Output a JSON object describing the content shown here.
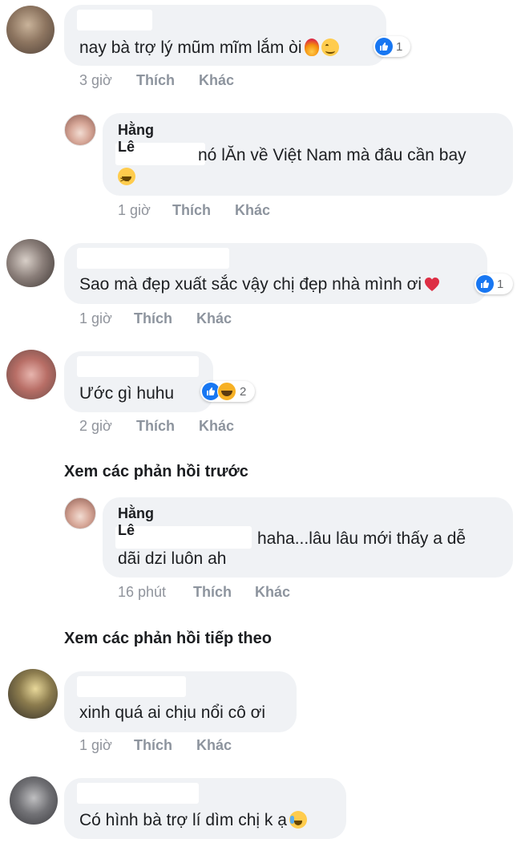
{
  "comments": [
    {
      "text": "nay bà trợ lý mũm mĩm lắm òi",
      "emoji": [
        "fire",
        "smile"
      ],
      "reaction_count": "1",
      "time": "3 giờ",
      "like_label": "Thích",
      "more_label": "Khác"
    },
    {
      "name": "Hằng Lê",
      "text_line1": "nó lĂn về Việt Nam mà đâu cần bay",
      "emoji": [
        "laugh"
      ],
      "time": "1 giờ",
      "like_label": "Thích",
      "more_label": "Khác"
    },
    {
      "text": "Sao mà đẹp xuất sắc vậy chị đẹp nhà mình ơi",
      "emoji": [
        "heart"
      ],
      "reaction_count": "1",
      "time": "1 giờ",
      "like_label": "Thích",
      "more_label": "Khác"
    },
    {
      "text": "Ước gì huhu",
      "reaction_count": "2",
      "time": "2 giờ",
      "like_label": "Thích",
      "more_label": "Khác"
    },
    {
      "name": "Hằng Lê",
      "text_line1": "haha...lâu lâu mới thấy a dễ",
      "text_line2": "dãi dzi luôn ah",
      "time": "16 phút",
      "like_label": "Thích",
      "more_label": "Khác"
    },
    {
      "text": "xinh quá ai chịu nổi cô ơi",
      "time": "1 giờ",
      "like_label": "Thích",
      "more_label": "Khác"
    },
    {
      "text": "Có hình bà trợ lí dìm chị k ạ",
      "emoji": [
        "cry"
      ]
    }
  ],
  "links": {
    "previous_replies": "Xem các phản hồi trước",
    "next_replies": "Xem các phản hồi tiếp theo"
  },
  "colors": {
    "bubble": "#f0f2f5",
    "meta_text": "#90949c",
    "like_blue": "#1877f2"
  }
}
